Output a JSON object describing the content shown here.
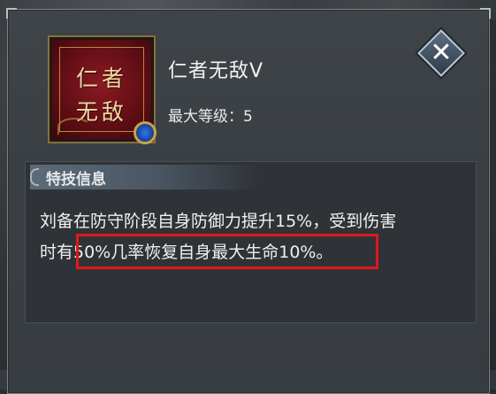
{
  "skill": {
    "icon_text_line1": "仁者",
    "icon_text_line2": "无敌",
    "name": "仁者无敌Ⅴ",
    "max_level": "最大等级：5"
  },
  "close_button": {
    "icon": "close-x-icon",
    "glyph": "✕"
  },
  "info": {
    "header": "特技信息",
    "description_line1": "刘备在防守阶段自身防御力提升15%，受到伤害",
    "description_line2": "时有50%几率恢复自身最大生命10%。"
  },
  "colors": {
    "highlight_border": "#e3161b",
    "icon_bg": "#7a1219",
    "panel_bg": "#3a3f43"
  }
}
